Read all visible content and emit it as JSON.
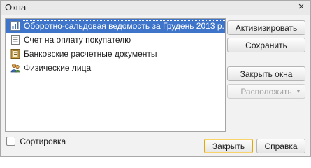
{
  "window": {
    "title": "Окна",
    "close_symbol": "×"
  },
  "list": {
    "items": [
      {
        "label": "Оборотно-сальдовая ведомость за Грудень 2013 р.",
        "icon": "report-icon",
        "selected": true
      },
      {
        "label": "Счет на оплату покупателю",
        "icon": "document-icon",
        "selected": false
      },
      {
        "label": "Банковские расчетные документы",
        "icon": "journal-icon",
        "selected": false
      },
      {
        "label": "Физические лица",
        "icon": "people-icon",
        "selected": false
      }
    ]
  },
  "buttons": {
    "activate": "Активизировать",
    "save": "Сохранить",
    "close_windows": "Закрыть окна",
    "arrange": "Расположить"
  },
  "sort": {
    "label": "Сортировка",
    "checked": false
  },
  "footer": {
    "close": "Закрыть",
    "help": "Справка"
  },
  "colors": {
    "selection": "#3e75ca",
    "default_button_border": "#e0a800"
  }
}
